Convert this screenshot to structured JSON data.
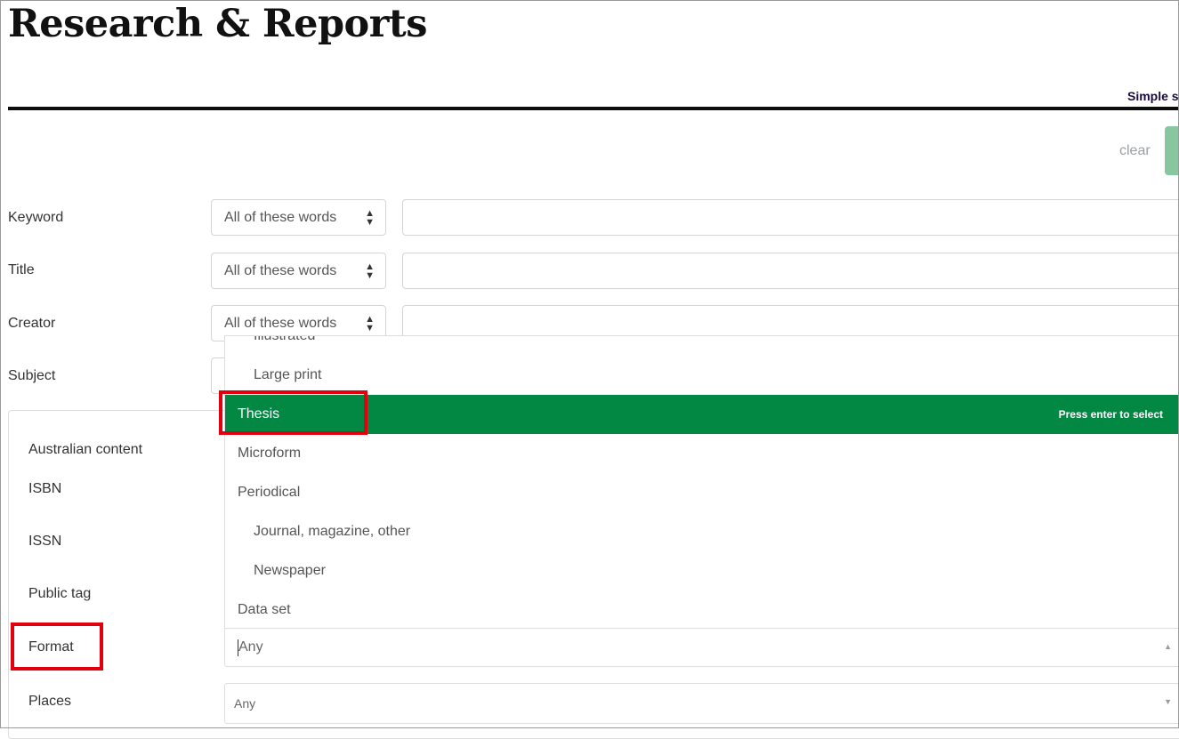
{
  "header": {
    "title": "Research & Reports",
    "simple_search_link": "Simple s",
    "clear_label": "clear"
  },
  "search_rows": [
    {
      "label": "Keyword",
      "mode": "All of these words"
    },
    {
      "label": "Title",
      "mode": "All of these words"
    },
    {
      "label": "Creator",
      "mode": "All of these words"
    },
    {
      "label": "Subject",
      "mode": ""
    }
  ],
  "panel": {
    "labels": [
      "Australian content",
      "ISBN",
      "ISSN",
      "Public tag",
      "Format",
      "Places"
    ]
  },
  "format_dropdown": {
    "items": [
      {
        "label": "Illustrated",
        "level": "child"
      },
      {
        "label": "Large print",
        "level": "child"
      },
      {
        "label": "Thesis",
        "level": "parent",
        "active": true
      },
      {
        "label": "Microform",
        "level": "parent"
      },
      {
        "label": "Periodical",
        "level": "parent"
      },
      {
        "label": "Journal, magazine, other",
        "level": "child"
      },
      {
        "label": "Newspaper",
        "level": "child"
      },
      {
        "label": "Data set",
        "level": "parent"
      }
    ],
    "hint": "Press enter to select",
    "active_color": "#028843"
  },
  "format_field": {
    "value": "Any"
  },
  "places_field": {
    "value": "Any"
  },
  "colors": {
    "highlight": "#e2000f",
    "accent_green": "#028843",
    "search_button": "#86c7a0"
  }
}
